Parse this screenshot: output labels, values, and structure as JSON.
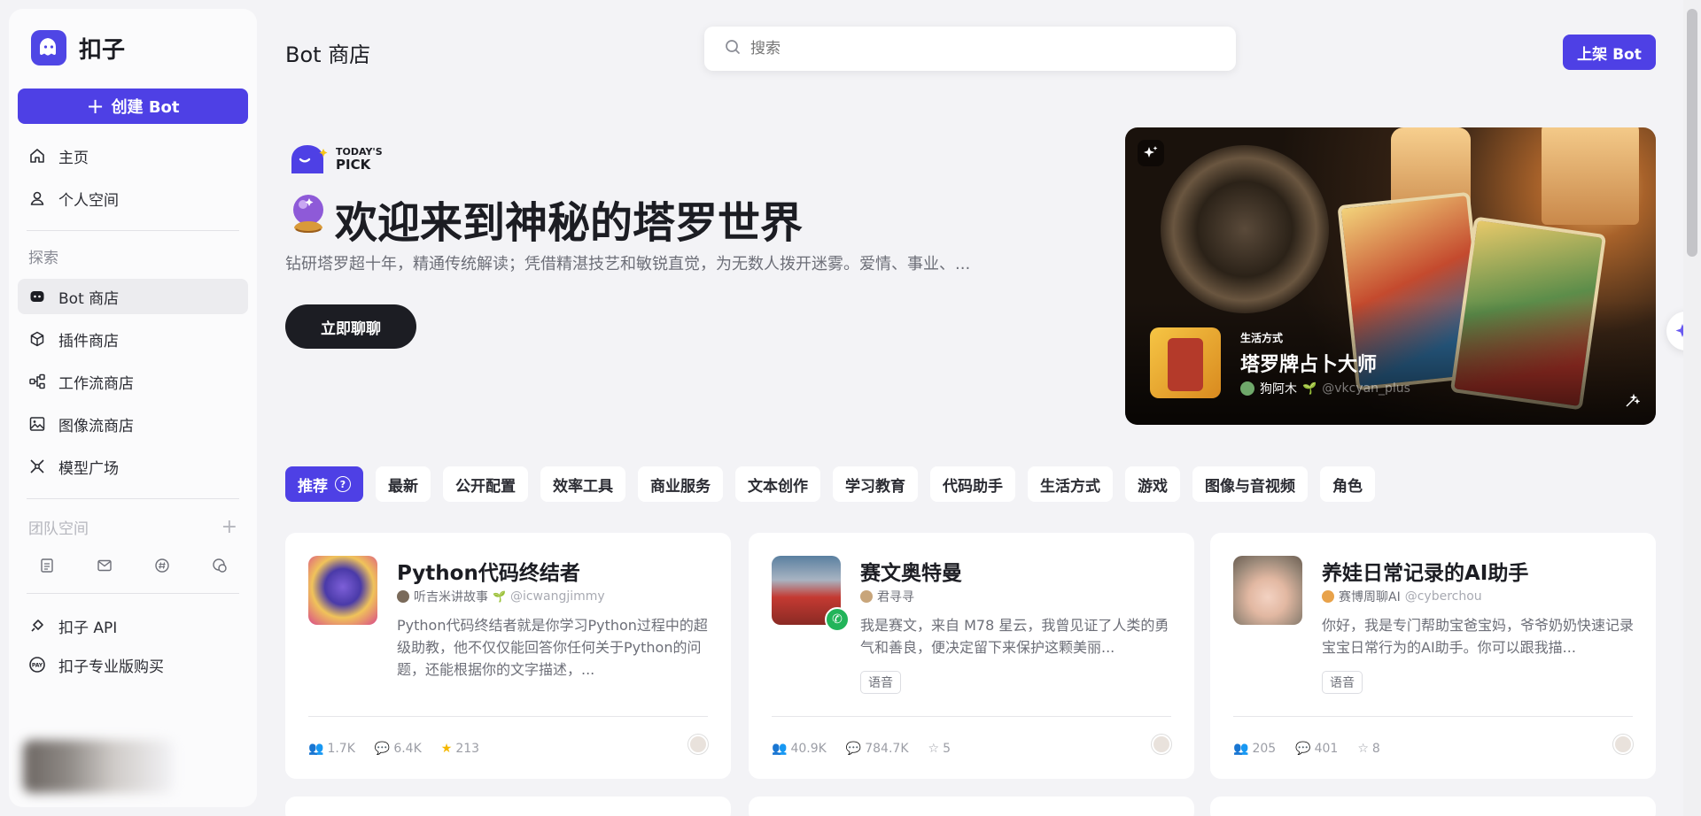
{
  "brand": {
    "name": "扣子"
  },
  "sidebar": {
    "create_label": "创建 Bot",
    "nav": [
      {
        "label": "主页",
        "icon": "home-icon"
      },
      {
        "label": "个人空间",
        "icon": "user-icon"
      }
    ],
    "explore_label": "探索",
    "explore": [
      {
        "label": "Bot 商店",
        "icon": "bot-icon",
        "active": true
      },
      {
        "label": "插件商店",
        "icon": "cube-icon"
      },
      {
        "label": "工作流商店",
        "icon": "workflow-icon"
      },
      {
        "label": "图像流商店",
        "icon": "image-icon"
      },
      {
        "label": "模型广场",
        "icon": "model-icon"
      }
    ],
    "team_label": "团队空间",
    "bottom": [
      {
        "label": "扣子 API",
        "icon": "api-icon"
      },
      {
        "label": "扣子专业版购买",
        "icon": "pay-icon"
      }
    ]
  },
  "header": {
    "title": "Bot 商店",
    "search_placeholder": "搜索",
    "publish_label": "上架 Bot"
  },
  "hero": {
    "pick_top": "TODAY'S",
    "pick_bottom": "PICK",
    "title": "欢迎来到神秘的塔罗世界",
    "desc": "钻研塔罗超十年，精通传统解读；凭借精湛技艺和敏锐直觉，为无数人拨开迷雾。爱情、事业、...",
    "cta": "立即聊聊",
    "card": {
      "category": "生活方式",
      "name": "塔罗牌占卜大师",
      "author": "狗阿木",
      "handle": "@vkcyan_plus"
    }
  },
  "tabs": [
    "推荐",
    "最新",
    "公开配置",
    "效率工具",
    "商业服务",
    "文本创作",
    "学习教育",
    "代码助手",
    "生活方式",
    "游戏",
    "图像与音视频",
    "角色"
  ],
  "cards": [
    {
      "title": "Python代码终结者",
      "author": "听吉米讲故事",
      "handle": "@icwangjimmy",
      "desc": "Python代码终结者就是你学习Python过程中的超级助教，他不仅仅能回答你任何关于Python的问题，还能根据你的文字描述，...",
      "tag": "",
      "users": "1.7K",
      "chats": "6.4K",
      "stars": "213"
    },
    {
      "title": "赛文奥特曼",
      "author": "君寻寻",
      "handle": "",
      "desc": "我是赛文，来自 M78 星云，我曾见证了人类的勇气和善良，便决定留下来保护这颗美丽...",
      "tag": "语音",
      "users": "40.9K",
      "chats": "784.7K",
      "stars": "5"
    },
    {
      "title": "养娃日常记录的AI助手",
      "author": "赛博周聊AI",
      "handle": "@cyberchou",
      "desc": "你好，我是专门帮助宝爸宝妈，爷爷奶奶快速记录宝宝日常行为的AI助手。你可以跟我描...",
      "tag": "语音",
      "users": "205",
      "chats": "401",
      "stars": "8"
    }
  ],
  "colors": {
    "accent": "#4e40e5",
    "dark": "#1c1d23",
    "star": "#f5b800"
  }
}
